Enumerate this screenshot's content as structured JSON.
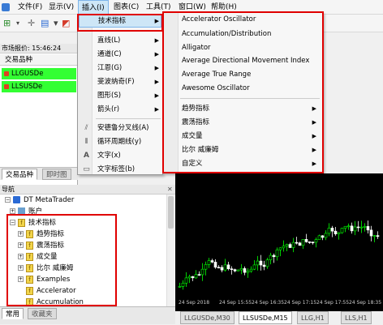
{
  "menubar": {
    "items": [
      "文件(F)",
      "显示(V)",
      "插入(I)",
      "图表(C)",
      "工具(T)",
      "窗口(W)",
      "帮助(H)"
    ]
  },
  "market_watch": {
    "title": "市场报价: 15:46:24",
    "column": "交易品种",
    "symbols": [
      "LLGUSDe",
      "LLSUSDe"
    ],
    "tabs": [
      "交易品种",
      "即时图"
    ]
  },
  "insert_menu": {
    "items": [
      {
        "label": "技术指标",
        "submenu": true
      },
      {
        "label": "直线(L)",
        "submenu": true
      },
      {
        "label": "通道(C)",
        "submenu": true
      },
      {
        "label": "江恩(G)",
        "submenu": true
      },
      {
        "label": "斐波纳奇(F)",
        "submenu": true
      },
      {
        "label": "图形(S)",
        "submenu": true
      },
      {
        "label": "箭头(r)",
        "submenu": true
      },
      {
        "label": "安德鲁分叉线(A)",
        "submenu": false
      },
      {
        "label": "循环周期线(y)",
        "submenu": false
      },
      {
        "label": "文字(x)",
        "submenu": false
      },
      {
        "label": "文字标签(b)",
        "submenu": false
      }
    ]
  },
  "indicators_menu": {
    "items": [
      "Accelerator Oscillator",
      "Accumulation/Distribution",
      "Alligator",
      "Average Directional Movement Index",
      "Average True Range",
      "Awesome Oscillator"
    ],
    "groups": [
      "趋势指标",
      "震荡指标",
      "成交量",
      "比尔 威廉姆",
      "自定义"
    ]
  },
  "navigator": {
    "title": "导航",
    "root": "DT MetaTrader",
    "items": [
      "账户",
      "技术指标",
      "趋势指标",
      "震荡指标",
      "成交量",
      "比尔 威廉姆",
      "Examples",
      "Accelerator",
      "Accumulation"
    ],
    "tabs": [
      "常用",
      "收藏夹"
    ]
  },
  "chart": {
    "dates": [
      "24 Sep 2018",
      "24 Sep 15:55",
      "24 Sep 16:35",
      "24 Sep 17:15",
      "24 Sep 17:55",
      "24 Sep 18:35",
      "24 Sep"
    ],
    "tabs": [
      "LLGUSDe,M30",
      "LLSUSDe,M15",
      "LLG,H1",
      "LLS,H1"
    ],
    "bull_color": "#00ff00",
    "bear_color": "#ffffff",
    "background": "#000000"
  },
  "highlight_color": "#e00000",
  "symbol_color": "#33ff33"
}
